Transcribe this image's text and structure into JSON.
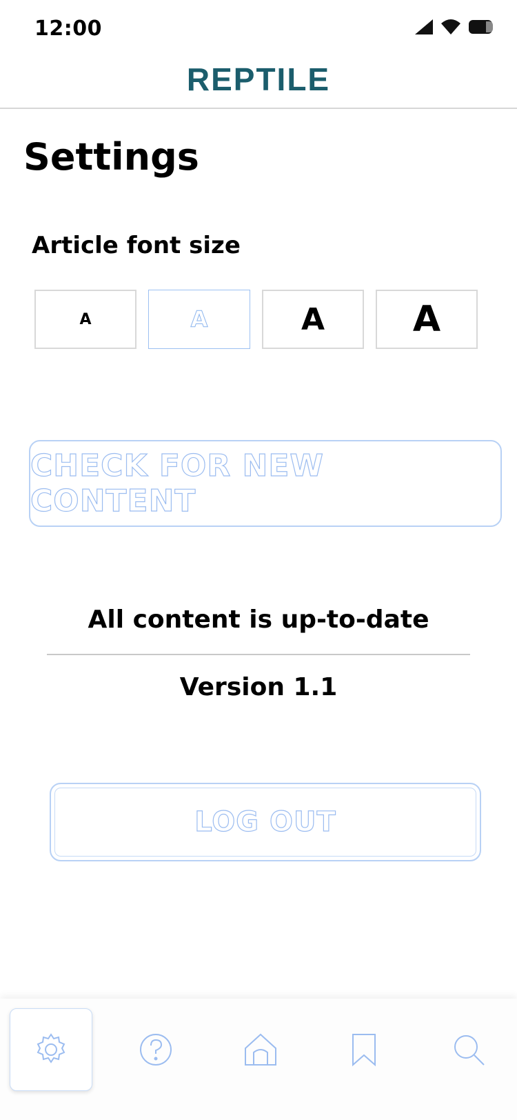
{
  "status_bar": {
    "time": "12:00"
  },
  "header": {
    "logo": "REPTILE",
    "brand_color": "#1b5d6c"
  },
  "page": {
    "title": "Settings"
  },
  "font_size": {
    "label": "Article font size",
    "options": [
      "A",
      "A",
      "A",
      "A"
    ],
    "selected_index": 1
  },
  "actions": {
    "check_content": "CHECK FOR NEW CONTENT",
    "logout": "LOG OUT"
  },
  "info": {
    "status": "All content is up-to-date",
    "version": "Version 1.1"
  },
  "bottom_nav": {
    "items": [
      {
        "icon": "gear-icon",
        "active": true
      },
      {
        "icon": "help-icon",
        "active": false
      },
      {
        "icon": "home-icon",
        "active": false
      },
      {
        "icon": "bookmark-icon",
        "active": false
      },
      {
        "icon": "search-icon",
        "active": false
      }
    ],
    "accent_color": "#9bbcf0"
  }
}
